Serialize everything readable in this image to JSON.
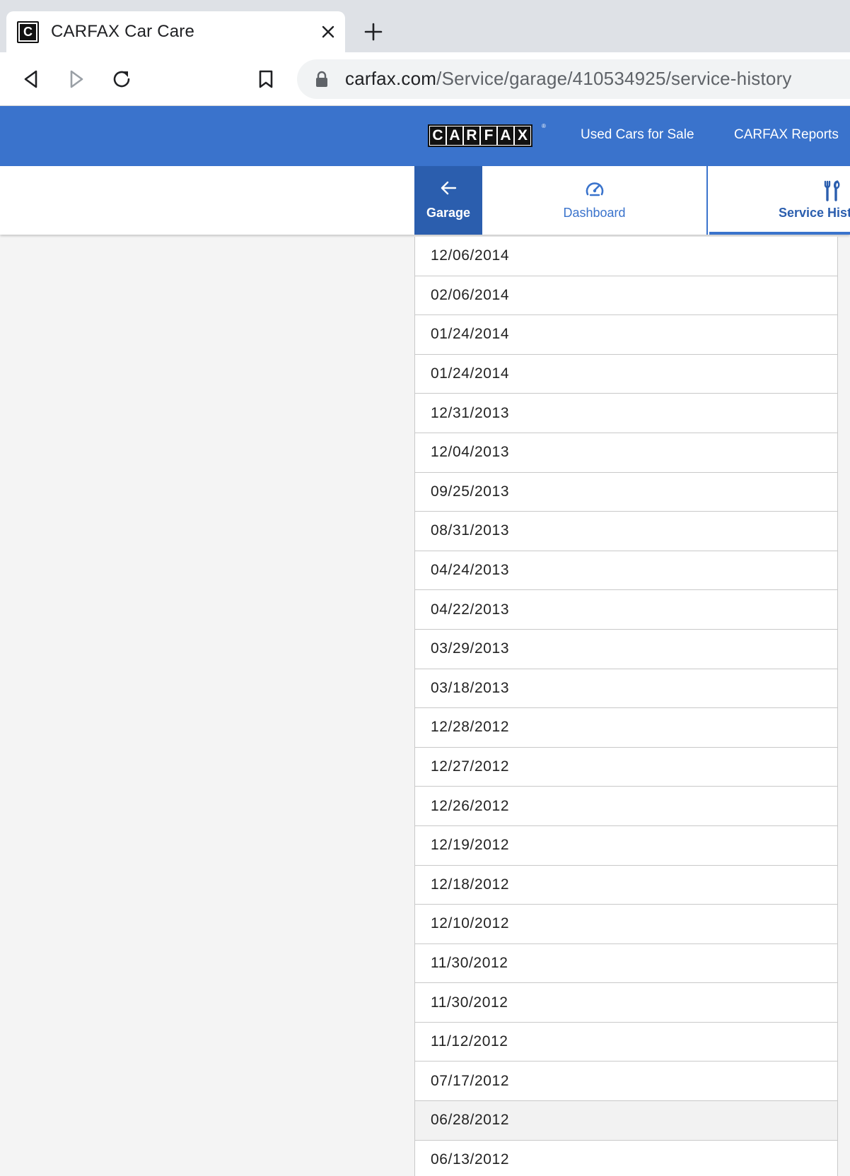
{
  "browser": {
    "tab_title": "CARFAX Car Care",
    "favicon_letter": "C",
    "url_domain": "carfax.com",
    "url_path": "/Service/garage/410534925/service-history"
  },
  "header": {
    "logo_letters": [
      "C",
      "A",
      "R",
      "F",
      "A",
      "X"
    ],
    "links": [
      "Used Cars for Sale",
      "CARFAX Reports"
    ]
  },
  "subnav": {
    "garage_label": "Garage",
    "dashboard_label": "Dashboard",
    "service_label": "Service Hist"
  },
  "service_dates": [
    "12/06/2014",
    "02/06/2014",
    "01/24/2014",
    "01/24/2014",
    "12/31/2013",
    "12/04/2013",
    "09/25/2013",
    "08/31/2013",
    "04/24/2013",
    "04/22/2013",
    "03/29/2013",
    "03/18/2013",
    "12/28/2012",
    "12/27/2012",
    "12/26/2012",
    "12/19/2012",
    "12/18/2012",
    "12/10/2012",
    "11/30/2012",
    "11/30/2012",
    "11/12/2012",
    "07/17/2012",
    "06/28/2012",
    "06/13/2012"
  ],
  "colors": {
    "brand_blue": "#3a73cc",
    "active_tab_blue": "#2b5eae",
    "page_bg": "#f4f4f4"
  },
  "icons": [
    "back-arrow-icon",
    "forward-arrow-icon",
    "reload-icon",
    "bookmark-icon",
    "lock-icon",
    "close-icon",
    "plus-icon",
    "arrow-left-icon",
    "speedometer-icon",
    "wrench-tools-icon"
  ]
}
